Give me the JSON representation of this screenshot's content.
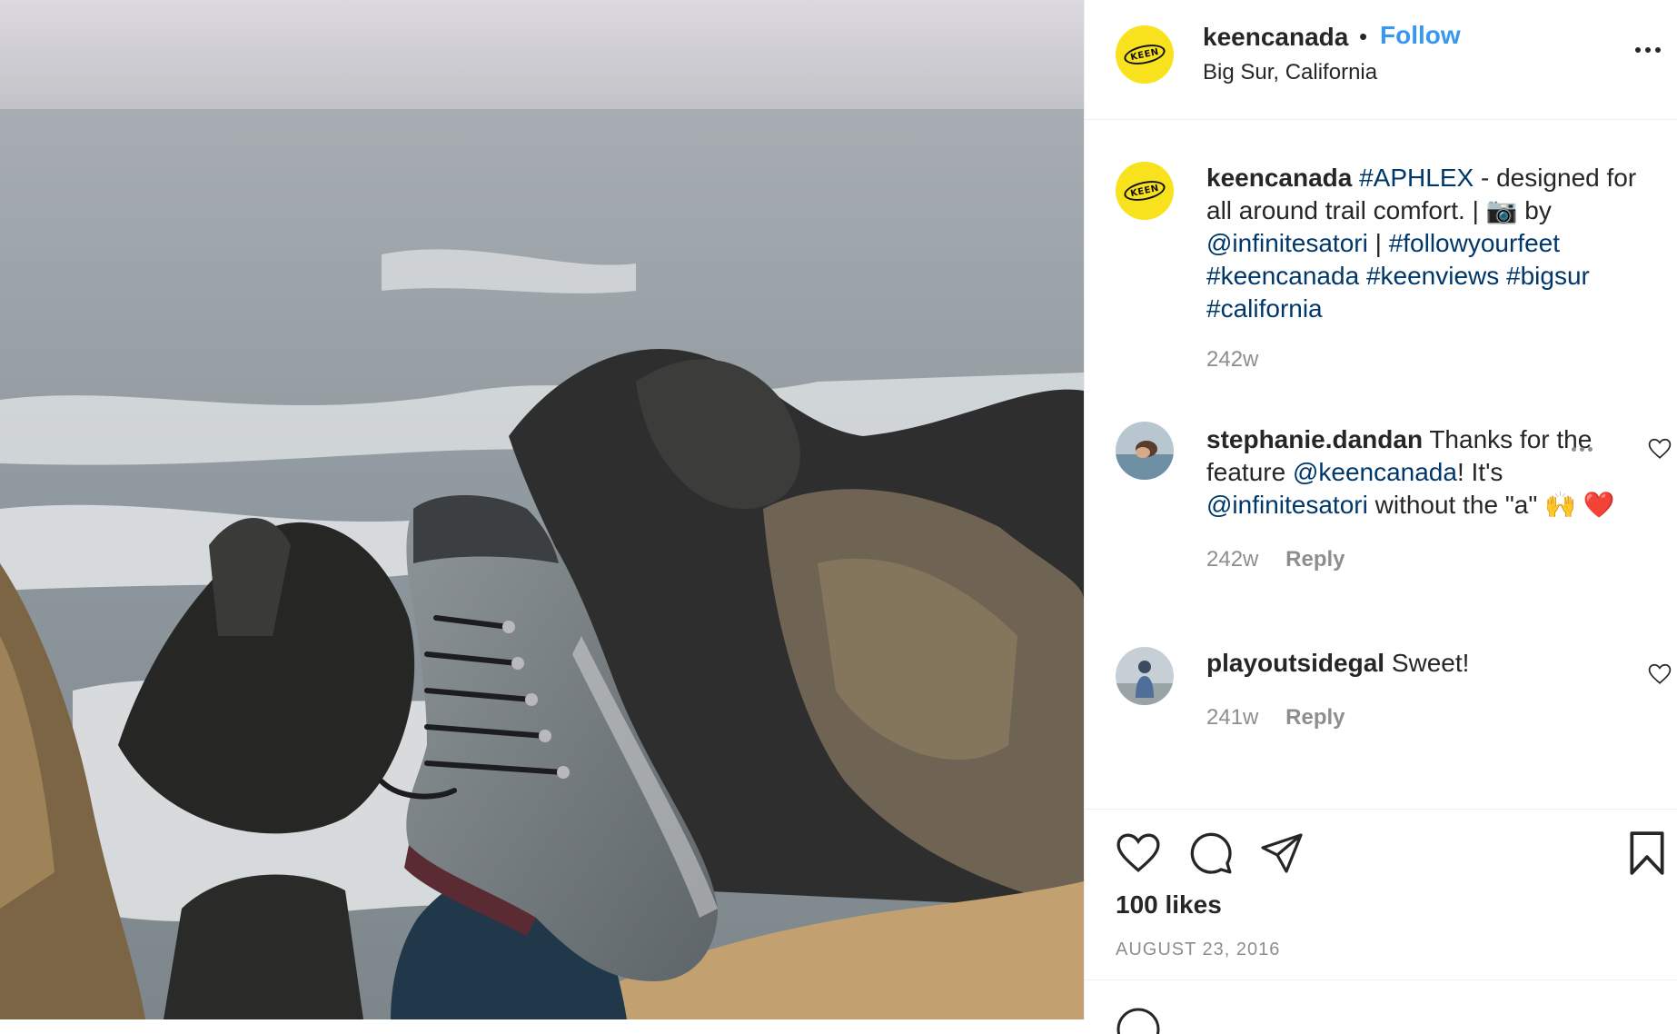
{
  "post": {
    "username": "keencanada",
    "separator": "•",
    "follow_label": "Follow",
    "location": "Big Sur, California",
    "logo_text": "KEEN",
    "caption": {
      "username": "keencanada",
      "tag_aphlex": "#APHLEX",
      "text1": " - designed for all around trail comfort. | 📷 by ",
      "mention": "@infinitesatori",
      "text2": " | ",
      "tag1": "#followyourfeet",
      "tag2": "#keencanada",
      "tag3": "#keenviews",
      "tag4": "#bigsur",
      "tag5": "#california",
      "time": "242w"
    },
    "comments": [
      {
        "username": "stephanie.dandan",
        "text1": " Thanks for the feature ",
        "mention1": "@keencanada",
        "text2": "! It's ",
        "mention2": "@infinitesatori",
        "text3": " without the \"a\" 🙌 ❤️",
        "time": "242w",
        "reply_label": "Reply"
      },
      {
        "username": "playoutsidegal",
        "text1": " Sweet!",
        "time": "241w",
        "reply_label": "Reply"
      }
    ],
    "likes": "100 likes",
    "date": "AUGUST 23, 2016"
  },
  "colors": {
    "accent": "#3897f0",
    "hashtag": "#00376b",
    "muted": "#8e8e8e",
    "keen_yellow": "#f7e21d"
  },
  "icons": [
    "more-icon",
    "heart-icon",
    "comment-icon",
    "share-icon",
    "bookmark-icon"
  ]
}
